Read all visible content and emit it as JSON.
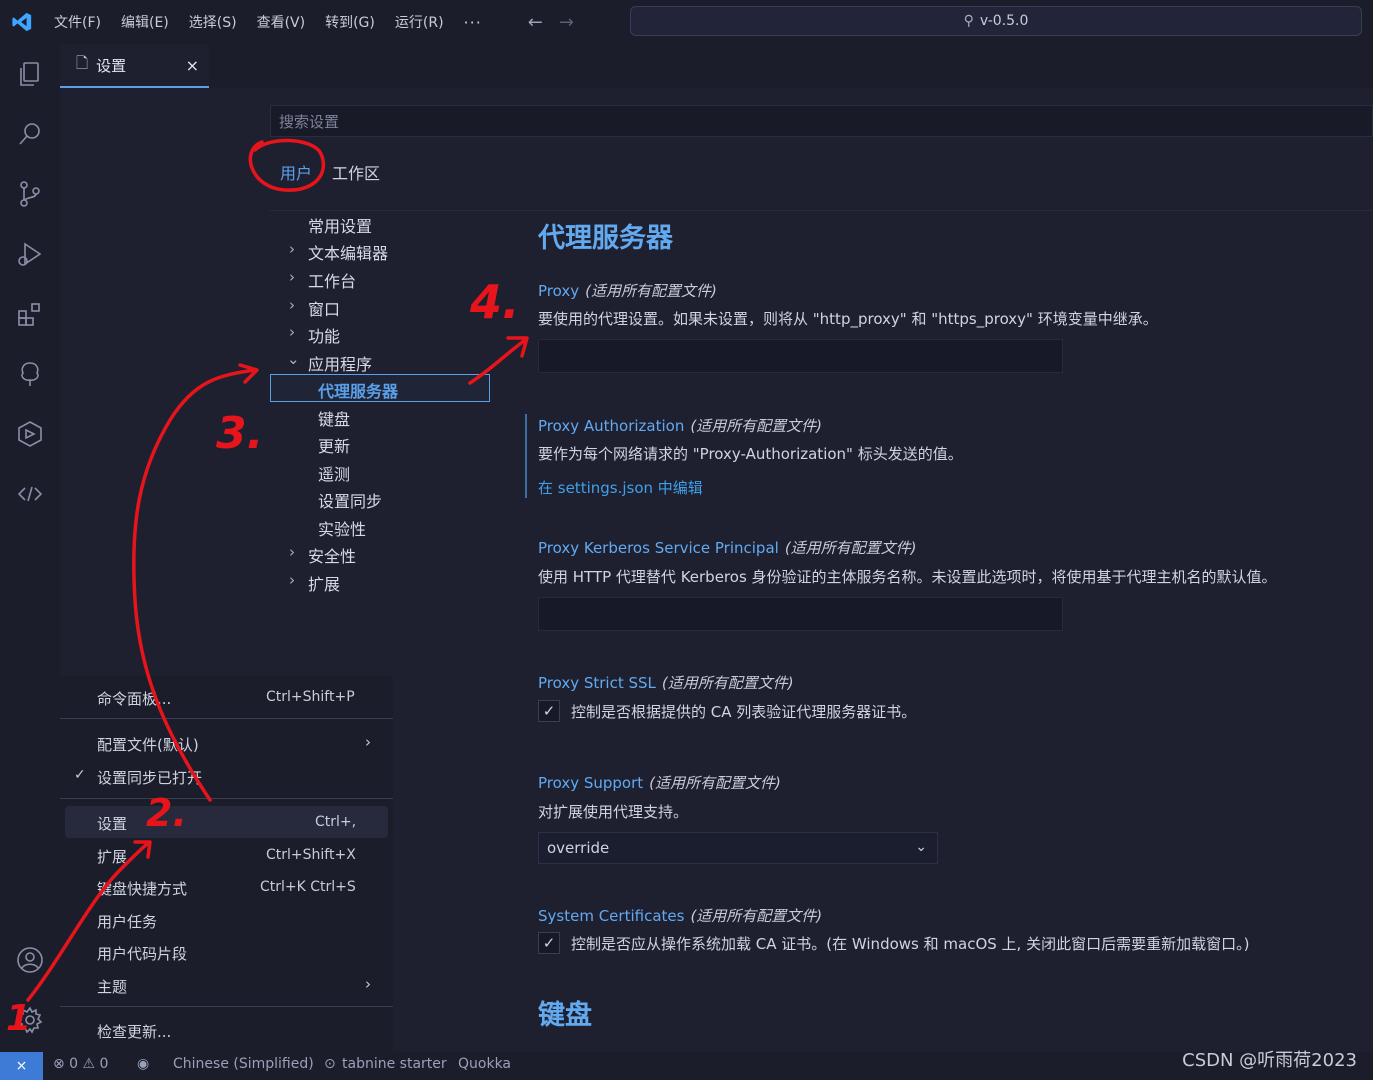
{
  "titlebar": {
    "menu": [
      "文件(F)",
      "编辑(E)",
      "选择(S)",
      "查看(V)",
      "转到(G)",
      "运行(R)"
    ],
    "more": "···",
    "search": "v-0.5.0"
  },
  "tab": {
    "label": "设置",
    "close": "×"
  },
  "search": {
    "placeholder": "搜索设置"
  },
  "scope": {
    "user": "用户",
    "workspace": "工作区"
  },
  "toc": {
    "common": "常用设置",
    "text_editor": "文本编辑器",
    "workbench": "工作台",
    "window": "窗口",
    "features": "功能",
    "application": "应用程序",
    "proxy": "代理服务器",
    "keyboard": "键盘",
    "update": "更新",
    "telemetry": "遥测",
    "sync": "设置同步",
    "experimental": "实验性",
    "security": "安全性",
    "extensions": "扩展"
  },
  "settings": {
    "section_title": "代理服务器",
    "scope_note": "(适用所有配置文件)",
    "proxy": {
      "name": "Proxy",
      "desc": "要使用的代理设置。如果未设置，则将从 \"http_proxy\" 和 \"https_proxy\" 环境变量中继承。"
    },
    "proxy_auth": {
      "name": "Proxy Authorization",
      "desc": "要作为每个网络请求的 \"Proxy-Authorization\" 标头发送的值。",
      "link": "在 settings.json 中编辑"
    },
    "kerberos": {
      "name": "Proxy Kerberos Service Principal",
      "desc": "使用 HTTP 代理替代 Kerberos 身份验证的主体服务名称。未设置此选项时，将使用基于代理主机名的默认值。"
    },
    "strict_ssl": {
      "name": "Proxy Strict SSL",
      "label": "控制是否根据提供的 CA 列表验证代理服务器证书。"
    },
    "support": {
      "name": "Proxy Support",
      "desc": "对扩展使用代理支持。",
      "value": "override"
    },
    "system_certs": {
      "name": "System Certificates",
      "label": "控制是否应从操作系统加载 CA 证书。(在 Windows 和 macOS 上, 关闭此窗口后需要重新加载窗口。)"
    },
    "next_section": "键盘"
  },
  "context_menu": {
    "command_palette": "命令面板...",
    "command_palette_key": "Ctrl+Shift+P",
    "profile": "配置文件(默认)",
    "sync_on": "设置同步已打开",
    "settings": "设置",
    "settings_key": "Ctrl+,",
    "extensions": "扩展",
    "extensions_key": "Ctrl+Shift+X",
    "keybindings": "键盘快捷方式",
    "keybindings_key": "Ctrl+K Ctrl+S",
    "user_tasks": "用户任务",
    "snippets": "用户代码片段",
    "themes": "主题",
    "check_updates": "检查更新..."
  },
  "statusbar": {
    "problems": "⊗ 0 ⚠ 0",
    "language": "Chinese (Simplified)",
    "tabnine": "tabnine starter",
    "quokka": "Quokka"
  },
  "watermark": "CSDN @听雨荷2023",
  "annotations": [
    "1",
    "2.",
    "3.",
    "4."
  ],
  "colors": {
    "accent": "#5aa0e8",
    "annotation": "#e8141c",
    "background": "#1e2030"
  }
}
